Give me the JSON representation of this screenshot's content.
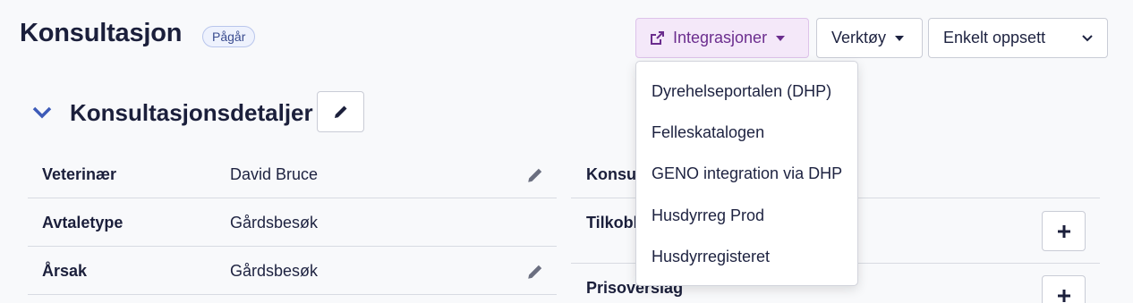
{
  "header": {
    "title": "Konsultasjon",
    "status": "Pågår"
  },
  "toolbar": {
    "integrations_label": "Integrasjoner",
    "tools_label": "Verktøy",
    "layout_select_value": "Enkelt oppsett"
  },
  "integrations_menu": {
    "items": [
      "Dyrehelseportalen (DHP)",
      "Felleskatalogen",
      "GENO integration via DHP",
      "Husdyrreg Prod",
      "Husdyrregisteret"
    ]
  },
  "section": {
    "title": "Konsultasjonsdetaljer"
  },
  "details": {
    "rows": [
      {
        "label": "Veterinær",
        "value": "David Bruce"
      },
      {
        "label": "Avtaletype",
        "value": "Gårdsbesøk"
      },
      {
        "label": "Årsak",
        "value": "Gårdsbesøk"
      }
    ]
  },
  "right_details": {
    "rows": [
      {
        "label": "Konsul"
      },
      {
        "label": "Tilkobl"
      },
      {
        "label": "Prisoverslag"
      }
    ]
  },
  "colors": {
    "accent_purple": "#6b2d8e",
    "chevron_blue": "#3d5bb8",
    "title_navy": "#1b1f3b"
  }
}
